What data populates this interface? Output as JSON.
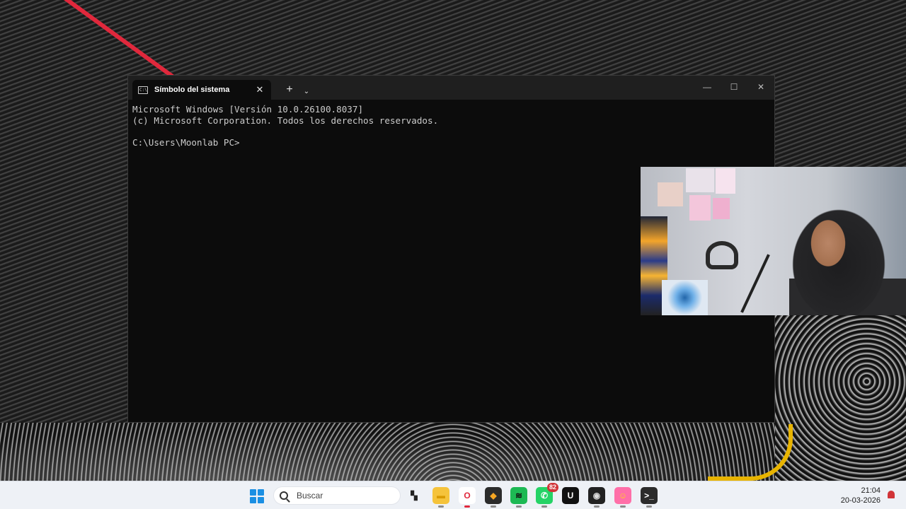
{
  "terminal": {
    "tab_title": "Símbolo del sistema",
    "tab_icon": "cmd-icon",
    "close_tab": "✕",
    "new_tab": "+",
    "dropdown": "⌄",
    "minimize": "—",
    "maximize": "☐",
    "close_window": "✕",
    "lines": [
      "Microsoft Windows [Versión 10.0.26100.8037]",
      "(c) Microsoft Corporation. Todos los derechos reservados.",
      "",
      "C:\\Users\\Moonlab PC>"
    ]
  },
  "taskbar": {
    "search_placeholder": "Buscar",
    "apps": [
      {
        "name": "task-view-icon",
        "glyph": "▚",
        "bg": "#eef1f6",
        "color": "#222"
      },
      {
        "name": "file-explorer-icon",
        "glyph": "▬",
        "bg": "#f5c33b",
        "color": "#d99a00"
      },
      {
        "name": "opera-icon",
        "glyph": "O",
        "bg": "#ffffff",
        "color": "#e0283c"
      },
      {
        "name": "fl-studio-icon",
        "glyph": "◆",
        "bg": "#2b2b2b",
        "color": "#f5a623"
      },
      {
        "name": "spotify-icon",
        "glyph": "≋",
        "bg": "#1db954",
        "color": "#111"
      },
      {
        "name": "whatsapp-icon",
        "glyph": "✆",
        "bg": "#25d366",
        "color": "#fff",
        "badge": "82"
      },
      {
        "name": "upwork-icon",
        "glyph": "U",
        "bg": "#111111",
        "color": "#ffffff"
      },
      {
        "name": "obs-icon",
        "glyph": "◉",
        "bg": "#222",
        "color": "#ddd"
      },
      {
        "name": "emoji-app-icon",
        "glyph": "☺",
        "bg": "#ff6fa8",
        "color": "#ffd21e"
      },
      {
        "name": "terminal-icon",
        "glyph": ">_",
        "bg": "#2b2b2b",
        "color": "#ffffff"
      }
    ],
    "time": "21:04",
    "date": "20-03-2026"
  }
}
